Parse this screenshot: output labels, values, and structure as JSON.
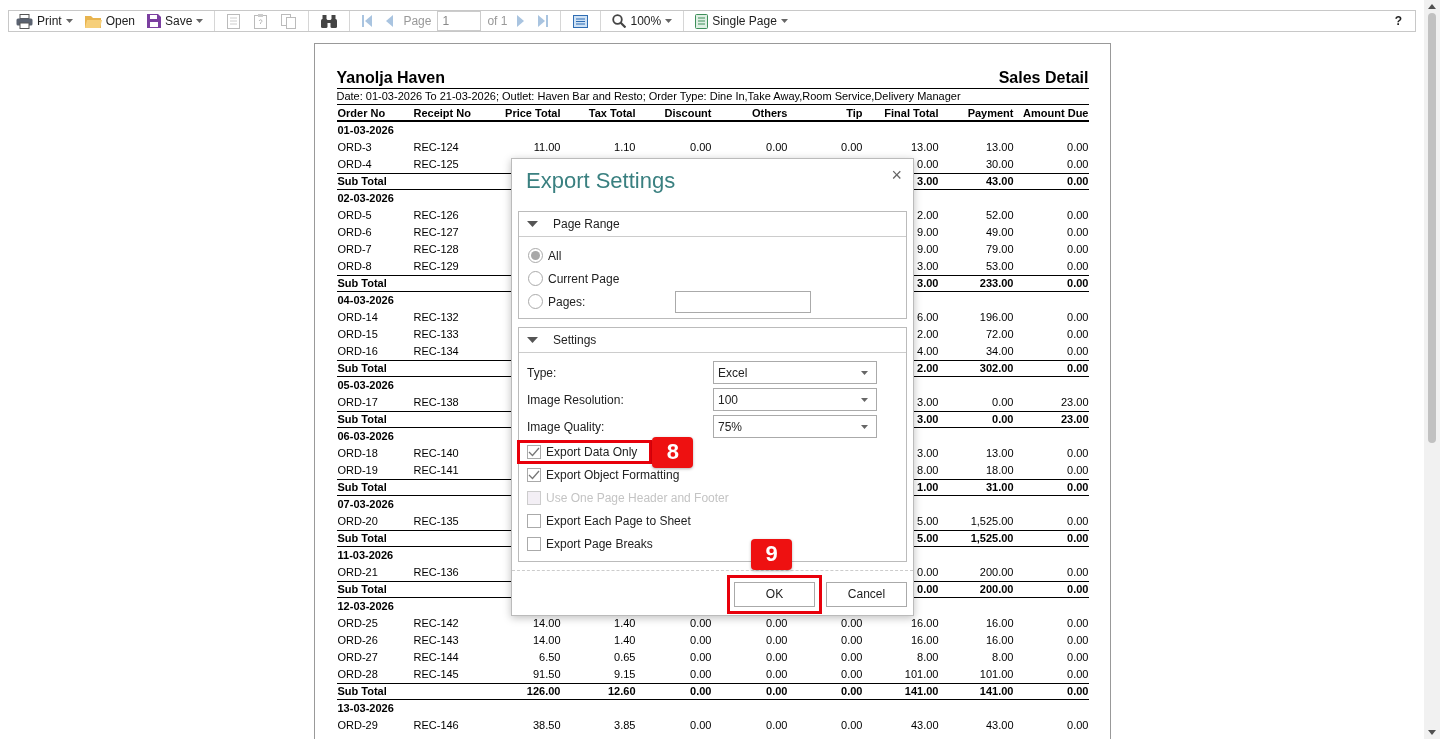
{
  "toolbar": {
    "print": "Print",
    "open": "Open",
    "save": "Save",
    "page_label": "Page",
    "page_value": "1",
    "page_of": "of 1",
    "zoom": "100%",
    "view_mode": "Single Page",
    "help": "?"
  },
  "report": {
    "title": "Yanolja Haven",
    "report_name": "Sales Detail",
    "filter_info": "Date: 01-03-2026 To 21-03-2026; Outlet: Haven Bar and Resto; Order Type: Dine In,Take Away,Room Service,Delivery Manager",
    "columns": [
      "Order No",
      "Receipt No",
      "Price Total",
      "Tax Total",
      "Discount",
      "Others",
      "Tip",
      "Final Total",
      "Payment",
      "Amount Due"
    ],
    "rows": [
      {
        "kind": "date",
        "text": "01-03-2026"
      },
      {
        "kind": "order",
        "cells": [
          "ORD-3",
          "REC-124",
          "11.00",
          "1.10",
          "0.00",
          "0.00",
          "0.00",
          "13.00",
          "13.00",
          "0.00"
        ]
      },
      {
        "kind": "order",
        "cells": [
          "ORD-4",
          "REC-125"
        ],
        "tail": [
          "0.00",
          "30.00",
          "0.00"
        ]
      },
      {
        "kind": "subtotal",
        "cells": [
          "Sub Total"
        ],
        "tail": [
          "3.00",
          "43.00",
          "0.00"
        ]
      },
      {
        "kind": "date",
        "text": "02-03-2026"
      },
      {
        "kind": "order",
        "cells": [
          "ORD-5",
          "REC-126"
        ],
        "tail": [
          "2.00",
          "52.00",
          "0.00"
        ]
      },
      {
        "kind": "order",
        "cells": [
          "ORD-6",
          "REC-127"
        ],
        "tail": [
          "9.00",
          "49.00",
          "0.00"
        ]
      },
      {
        "kind": "order",
        "cells": [
          "ORD-7",
          "REC-128"
        ],
        "tail": [
          "9.00",
          "79.00",
          "0.00"
        ]
      },
      {
        "kind": "order",
        "cells": [
          "ORD-8",
          "REC-129"
        ],
        "tail": [
          "3.00",
          "53.00",
          "0.00"
        ]
      },
      {
        "kind": "subtotal",
        "cells": [
          "Sub Total"
        ],
        "tail": [
          "3.00",
          "233.00",
          "0.00"
        ]
      },
      {
        "kind": "date",
        "text": "04-03-2026"
      },
      {
        "kind": "order",
        "cells": [
          "ORD-14",
          "REC-132"
        ],
        "tail": [
          "6.00",
          "196.00",
          "0.00"
        ]
      },
      {
        "kind": "order",
        "cells": [
          "ORD-15",
          "REC-133"
        ],
        "tail": [
          "2.00",
          "72.00",
          "0.00"
        ]
      },
      {
        "kind": "order",
        "cells": [
          "ORD-16",
          "REC-134"
        ],
        "tail": [
          "4.00",
          "34.00",
          "0.00"
        ]
      },
      {
        "kind": "subtotal",
        "cells": [
          "Sub Total"
        ],
        "tail": [
          "2.00",
          "302.00",
          "0.00"
        ]
      },
      {
        "kind": "date",
        "text": "05-03-2026"
      },
      {
        "kind": "order",
        "cells": [
          "ORD-17",
          "REC-138"
        ],
        "tail": [
          "3.00",
          "0.00",
          "23.00"
        ]
      },
      {
        "kind": "subtotal",
        "cells": [
          "Sub Total"
        ],
        "tail": [
          "3.00",
          "0.00",
          "23.00"
        ]
      },
      {
        "kind": "date",
        "text": "06-03-2026"
      },
      {
        "kind": "order",
        "cells": [
          "ORD-18",
          "REC-140"
        ],
        "tail": [
          "3.00",
          "13.00",
          "0.00"
        ]
      },
      {
        "kind": "order",
        "cells": [
          "ORD-19",
          "REC-141"
        ],
        "tail": [
          "8.00",
          "18.00",
          "0.00"
        ]
      },
      {
        "kind": "subtotal",
        "cells": [
          "Sub Total"
        ],
        "tail": [
          "1.00",
          "31.00",
          "0.00"
        ]
      },
      {
        "kind": "date",
        "text": "07-03-2026"
      },
      {
        "kind": "order",
        "cells": [
          "ORD-20",
          "REC-135"
        ],
        "tail": [
          "5.00",
          "1,525.00",
          "0.00"
        ]
      },
      {
        "kind": "subtotal",
        "cells": [
          "Sub Total"
        ],
        "tail": [
          "5.00",
          "1,525.00",
          "0.00"
        ]
      },
      {
        "kind": "date",
        "text": "11-03-2026"
      },
      {
        "kind": "order",
        "cells": [
          "ORD-21",
          "REC-136"
        ],
        "tail": [
          "0.00",
          "200.00",
          "0.00"
        ]
      },
      {
        "kind": "subtotal",
        "cells": [
          "Sub Total"
        ],
        "tail": [
          "0.00",
          "200.00",
          "0.00"
        ]
      },
      {
        "kind": "date",
        "text": "12-03-2026"
      },
      {
        "kind": "order",
        "cells": [
          "ORD-25",
          "REC-142",
          "14.00",
          "1.40",
          "0.00",
          "0.00",
          "0.00",
          "16.00",
          "16.00",
          "0.00"
        ]
      },
      {
        "kind": "order",
        "cells": [
          "ORD-26",
          "REC-143",
          "14.00",
          "1.40",
          "0.00",
          "0.00",
          "0.00",
          "16.00",
          "16.00",
          "0.00"
        ]
      },
      {
        "kind": "order",
        "cells": [
          "ORD-27",
          "REC-144",
          "6.50",
          "0.65",
          "0.00",
          "0.00",
          "0.00",
          "8.00",
          "8.00",
          "0.00"
        ]
      },
      {
        "kind": "order",
        "cells": [
          "ORD-28",
          "REC-145",
          "91.50",
          "9.15",
          "0.00",
          "0.00",
          "0.00",
          "101.00",
          "101.00",
          "0.00"
        ]
      },
      {
        "kind": "subtotal",
        "cells": [
          "Sub Total"
        ],
        "tail": [
          "126.00",
          "12.60",
          "0.00",
          "0.00",
          "0.00",
          "141.00",
          "141.00",
          "0.00"
        ]
      },
      {
        "kind": "date",
        "text": "13-03-2026"
      },
      {
        "kind": "order",
        "cells": [
          "ORD-29",
          "REC-146",
          "38.50",
          "3.85",
          "0.00",
          "0.00",
          "0.00",
          "43.00",
          "43.00",
          "0.00"
        ]
      }
    ]
  },
  "dialog": {
    "title": "Export Settings",
    "close": "×",
    "page_range": {
      "title": "Page Range",
      "expanded": true,
      "options": [
        {
          "label": "All",
          "selected": true
        },
        {
          "label": "Current Page",
          "selected": false
        },
        {
          "label": "Pages:",
          "selected": false
        }
      ]
    },
    "settings": {
      "title": "Settings",
      "expanded": true,
      "fields": [
        {
          "label": "Type:",
          "value": "Excel"
        },
        {
          "label": "Image Resolution:",
          "value": "100"
        },
        {
          "label": "Image Quality:",
          "value": "75%"
        }
      ],
      "checkboxes": [
        {
          "label": "Export Data Only",
          "checked": true,
          "disabled": false,
          "callout": "8"
        },
        {
          "label": "Export Object Formatting",
          "checked": true,
          "disabled": false
        },
        {
          "label": "Use One Page Header and Footer",
          "checked": false,
          "disabled": true
        },
        {
          "label": "Export Each Page to Sheet",
          "checked": false,
          "disabled": false
        },
        {
          "label": "Export Page Breaks",
          "checked": false,
          "disabled": false
        }
      ]
    },
    "buttons": [
      {
        "label": "OK",
        "callout": "9"
      },
      {
        "label": "Cancel"
      }
    ]
  }
}
